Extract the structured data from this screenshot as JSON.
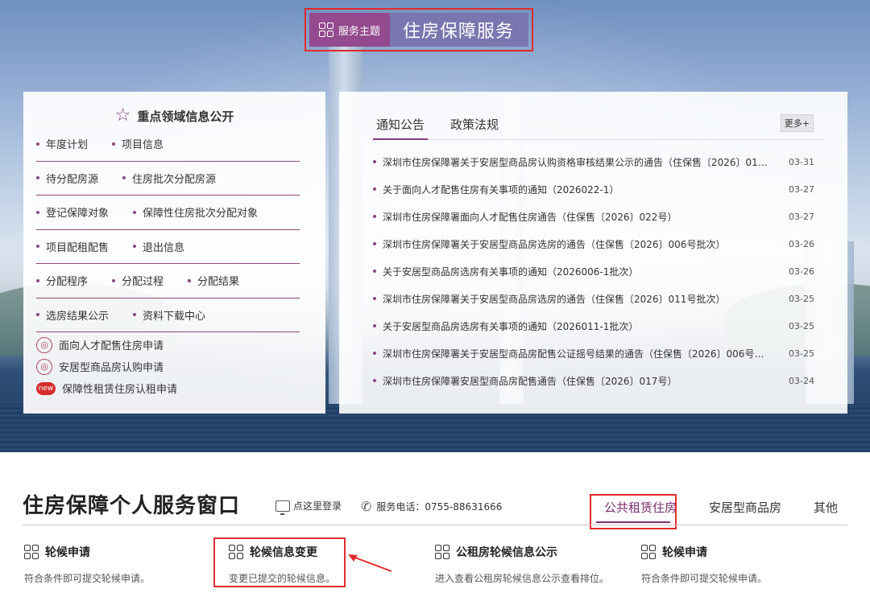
{
  "theme": {
    "label": "服务主题",
    "title": "住房保障服务"
  },
  "left_panel": {
    "title": "重点领域信息公开",
    "rows": [
      [
        "年度计划",
        "项目信息"
      ],
      [
        "待分配房源",
        "住房批次分配房源"
      ],
      [
        "登记保障对象",
        "保障性住房批次分配对象"
      ],
      [
        "项目配租配售",
        "退出信息"
      ],
      [
        "分配程序",
        "分配过程",
        "分配结果"
      ],
      [
        "选房结果公示",
        "资料下载中心"
      ]
    ],
    "applications": [
      {
        "label": "面向人才配售住房申请",
        "icon": "seal-icon"
      },
      {
        "label": "安居型商品房认购申请",
        "icon": "seal-icon"
      },
      {
        "label": "保障性租赁住房认租申请",
        "icon": "new-badge-icon",
        "badge": "new"
      }
    ]
  },
  "right_panel": {
    "tabs": [
      "通知公告",
      "政策法规"
    ],
    "active_tab": "通知公告",
    "more": "更多+",
    "notices": [
      {
        "title": "深圳市住房保障署关于安居型商品房认购资格审核结果公示的通告（住保售〔2026〕014...",
        "date": "03-31"
      },
      {
        "title": "关于面向人才配售住房有关事项的通知（2026022-1）",
        "date": "03-27"
      },
      {
        "title": "深圳市住房保障署面向人才配售住房通告（住保售〔2026〕022号）",
        "date": "03-27"
      },
      {
        "title": "深圳市住房保障署关于安居型商品房选房的通告（住保售〔2026〕006号批次）",
        "date": "03-26"
      },
      {
        "title": "关于安居型商品房选房有关事项的通知（2026006-1批次）",
        "date": "03-26"
      },
      {
        "title": "深圳市住房保障署关于安居型商品房选房的通告（住保售〔2026〕011号批次）",
        "date": "03-25"
      },
      {
        "title": "关于安居型商品房选房有关事项的通知（2026011-1批次）",
        "date": "03-25"
      },
      {
        "title": "深圳市住房保障署关于安居型商品房配售公证摇号结果的通告（住保售〔2026〕006号批...",
        "date": "03-25"
      },
      {
        "title": "深圳市住房保障署安居型商品房配售通告（住保售〔2026〕017号）",
        "date": "03-24"
      }
    ]
  },
  "service_window": {
    "title": "住房保障个人服务窗口",
    "login": "点这里登录",
    "phone": "服务电话：0755-88631666",
    "categories": [
      "公共租赁住房",
      "安居型商品房",
      "其他"
    ],
    "active_category": "公共租赁住房",
    "items": [
      {
        "title": "轮候申请",
        "desc": "符合条件即可提交轮候申请。"
      },
      {
        "title": "轮候信息变更",
        "desc": "变更已提交的轮候信息。"
      },
      {
        "title": "公租房轮候信息公示",
        "desc": "进入查看公租房轮候信息公示查看排位。"
      },
      {
        "title": "轮候申请",
        "desc": "符合条件即可提交轮候申请。"
      }
    ]
  },
  "colors": {
    "accent": "#8a3a7a",
    "highlight": "#e12b2b",
    "theme_bg": "#786eaa"
  }
}
